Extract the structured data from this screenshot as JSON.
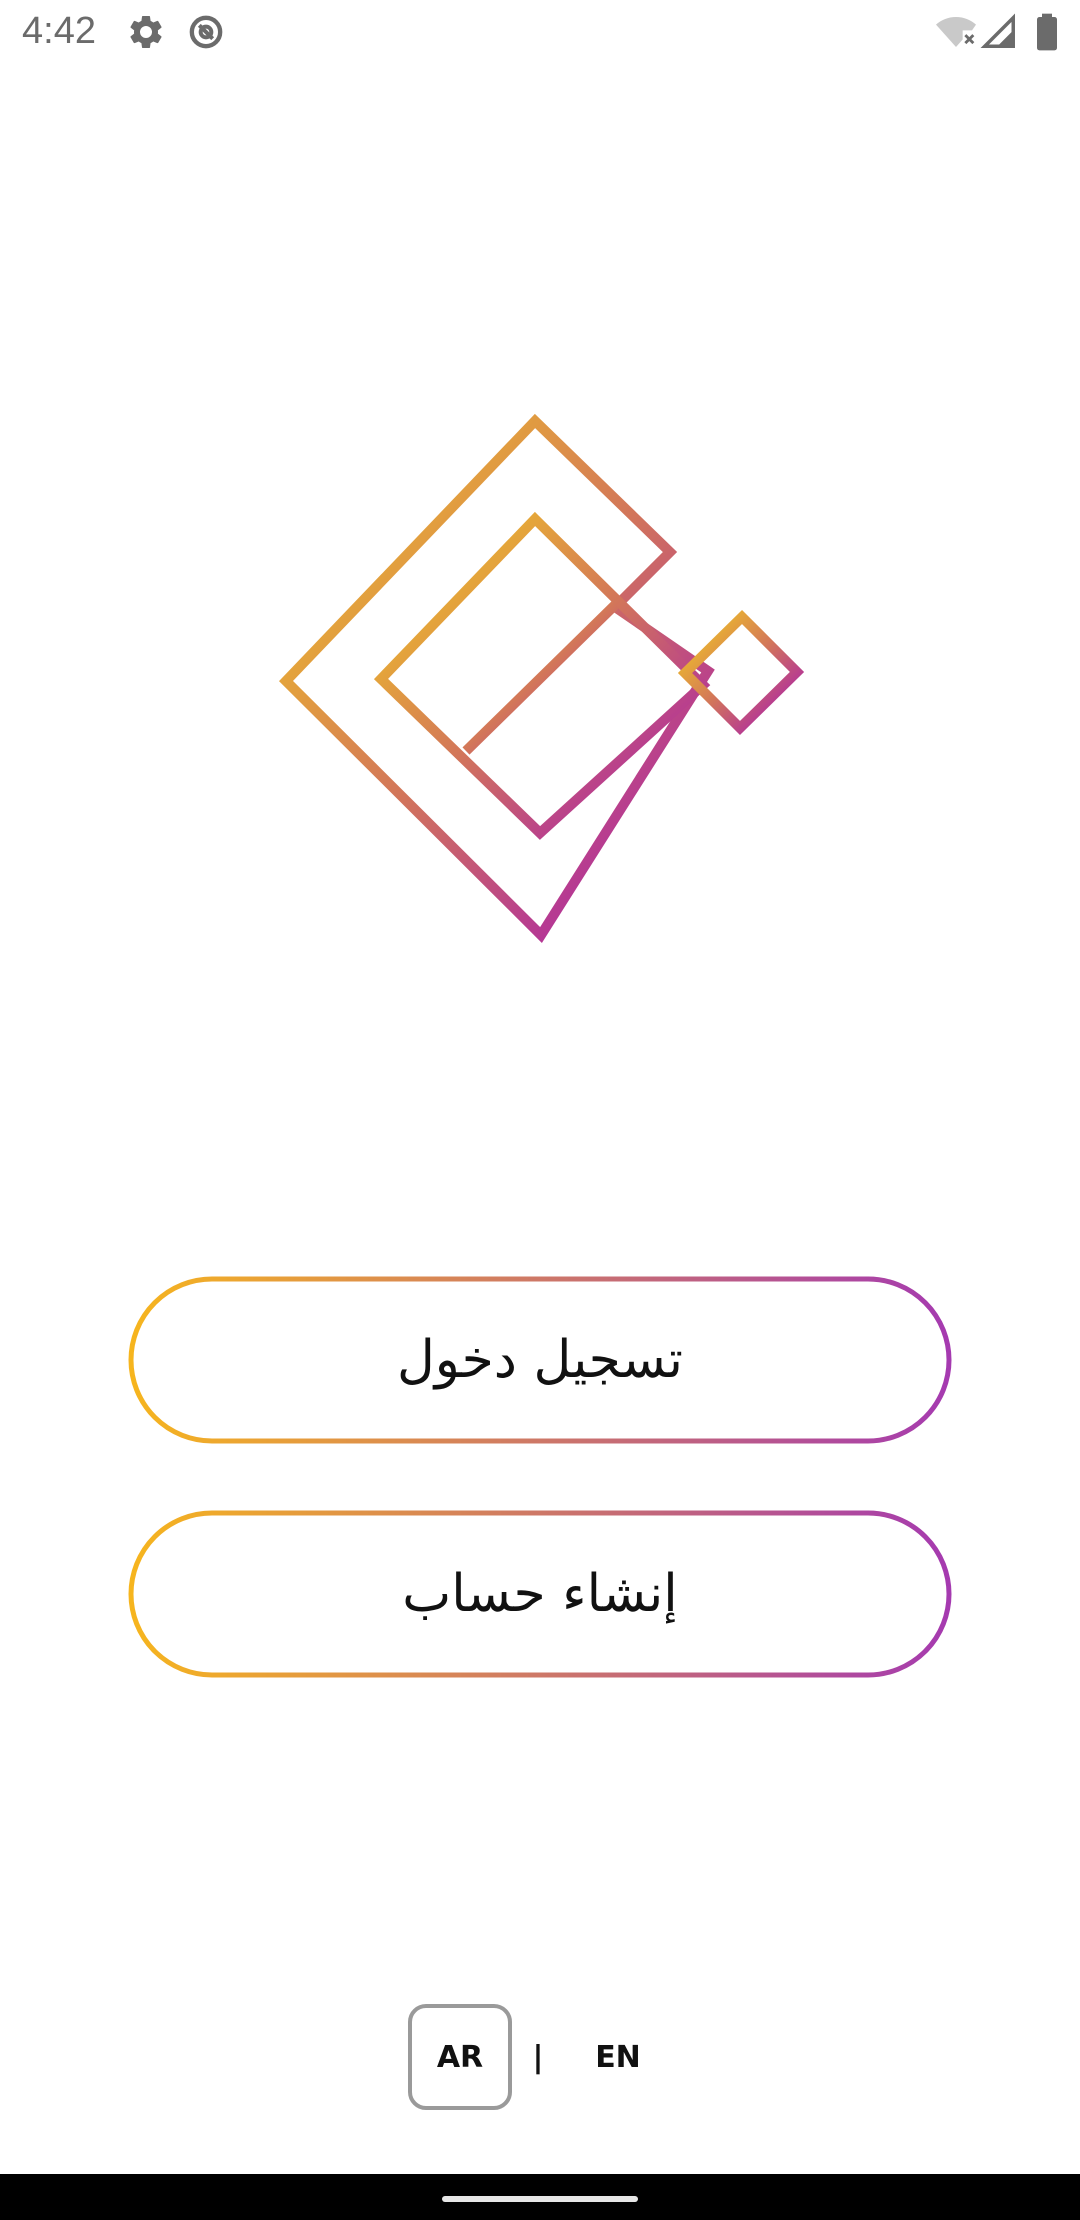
{
  "status_bar": {
    "time": "4:42",
    "icons": {
      "settings": "gear-icon",
      "data_saver": "data-saver-icon",
      "wifi": "wifi-off-icon",
      "signal": "cell-signal-icon",
      "battery": "battery-icon"
    }
  },
  "logo": {
    "icon": "nested-diamond-logo",
    "gradient_start": "#F5D01E",
    "gradient_mid": "#D2755A",
    "gradient_end": "#A312B8"
  },
  "buttons": {
    "login_label": "تسجيل دخول",
    "register_label": "إنشاء حساب",
    "border_gradient_start": "#F6B51E",
    "border_gradient_end": "#A53AB0"
  },
  "language": {
    "ar_label": "AR",
    "separator": "|",
    "en_label": "EN",
    "selected": "AR"
  }
}
